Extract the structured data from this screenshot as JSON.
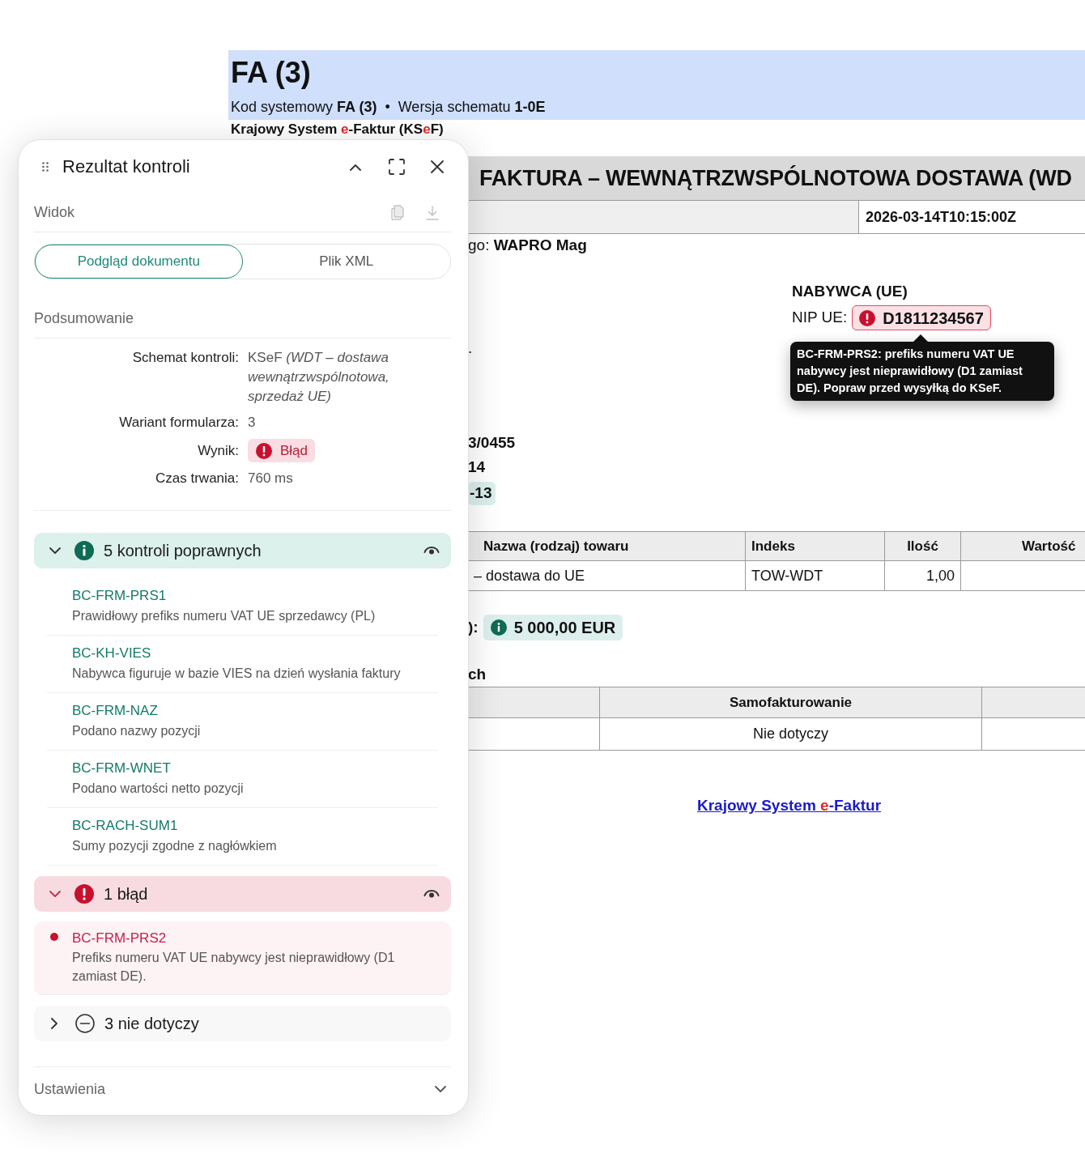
{
  "document": {
    "title": "FA (3)",
    "meta": [
      "Kod systemowy **FA (3)**",
      "Wersja schematu **1-0E**"
    ],
    "meta_separator": "•",
    "system_name": [
      {
        "text": "Krajowy System ",
        "accent": false
      },
      {
        "text": "e",
        "accent": true
      },
      {
        "text": "-Faktur (KS",
        "accent": false
      },
      {
        "text": "e",
        "accent": true
      },
      {
        "text": "F)",
        "accent": false
      }
    ]
  },
  "invoice": {
    "title": "FAKTURA – WEWNĄTRZWSPÓLNOTOWA DOSTAWA (WD",
    "issue_date": "2026-03-14T10:15:00Z",
    "software_line": "go: **WAPRO Mag**",
    "seller_fragment": ".",
    "buyer": {
      "heading": "NABYWCA (UE)",
      "nip_label": "NIP UE:",
      "nip_badge": {
        "kind": "error",
        "value": "D1811234567"
      },
      "tooltip": "BC-FRM-PRS2: prefiks numeru VAT UE nabywcy jest nieprawidłowy (D1 zamiast DE). Popraw przed wysyłką do KSeF."
    },
    "details": [
      {
        "text": "3/0455",
        "highlighted": false
      },
      {
        "text": "14",
        "highlighted": false
      },
      {
        "text": "-13",
        "highlighted": true
      }
    ],
    "items_table": {
      "columns": [
        "Nazwa (rodzaj) towaru",
        "Indeks",
        "Ilość",
        "Wartość"
      ],
      "rows": [
        [
          "– dostawa do UE",
          "TOW-WDT",
          "1,00"
        ]
      ]
    },
    "total": {
      "label_fragment": "):",
      "badge": {
        "kind": "ok",
        "value": "5 000,00 EUR"
      }
    },
    "section_fragment": "ch",
    "flags_table": {
      "column_2": "Samofakturowanie",
      "rows": [
        {
          "column_2": "Nie dotyczy"
        }
      ]
    },
    "footer_link": [
      {
        "text": "Krajowy System ",
        "accent": false
      },
      {
        "text": "e",
        "accent": true
      },
      {
        "text": "-Faktur",
        "accent": false
      }
    ]
  },
  "panel": {
    "title": "Rezultat kontroli",
    "view_label": "Widok",
    "view_tabs": [
      {
        "label": "Podgląd dokumentu",
        "selected": true
      },
      {
        "label": "Plik XML",
        "selected": false
      }
    ],
    "summary_label": "Podsumowanie",
    "summary": [
      {
        "kind": "text",
        "label": "Schemat kontroli:",
        "value": "KSeF *(WDT – dostawa wewnątrzwspólnotowa, sprzedaż UE)*"
      },
      {
        "kind": "text",
        "label": "Wariant formularza:",
        "value": "3"
      },
      {
        "kind": "badge",
        "label": "Wynik:",
        "badge": {
          "kind": "error",
          "value": "Błąd"
        }
      },
      {
        "kind": "text",
        "label": "Czas trwania:",
        "value": "760 ms"
      }
    ],
    "groups": [
      {
        "kind": "ok",
        "label": "5 kontroli poprawnych",
        "expanded": true,
        "show_in_preview": true,
        "items": [
          {
            "code": "BC-FRM-PRS1",
            "description": "Prawidłowy prefiks numeru VAT UE sprzedawcy (PL)"
          },
          {
            "code": "BC-KH-VIES",
            "description": "Nabywca figuruje w bazie VIES na dzień wysłania faktury"
          },
          {
            "code": "BC-FRM-NAZ",
            "description": "Podano nazwy pozycji"
          },
          {
            "code": "BC-FRM-WNET",
            "description": "Podano wartości netto pozycji"
          },
          {
            "code": "BC-RACH-SUM1",
            "description": "Sumy pozycji zgodne z nagłówkiem"
          }
        ]
      },
      {
        "kind": "error",
        "label": "1 błąd",
        "expanded": true,
        "show_in_preview": true,
        "items": [
          {
            "code": "BC-FRM-PRS2",
            "description": "Prefiks numeru VAT UE nabywcy jest nieprawidłowy (D1 zamiast DE)."
          }
        ]
      },
      {
        "kind": "na",
        "label": "3 nie dotyczy",
        "expanded": false,
        "show_in_preview": false
      }
    ],
    "settings": {
      "label": "Ustawienia",
      "expanded": false
    }
  }
}
